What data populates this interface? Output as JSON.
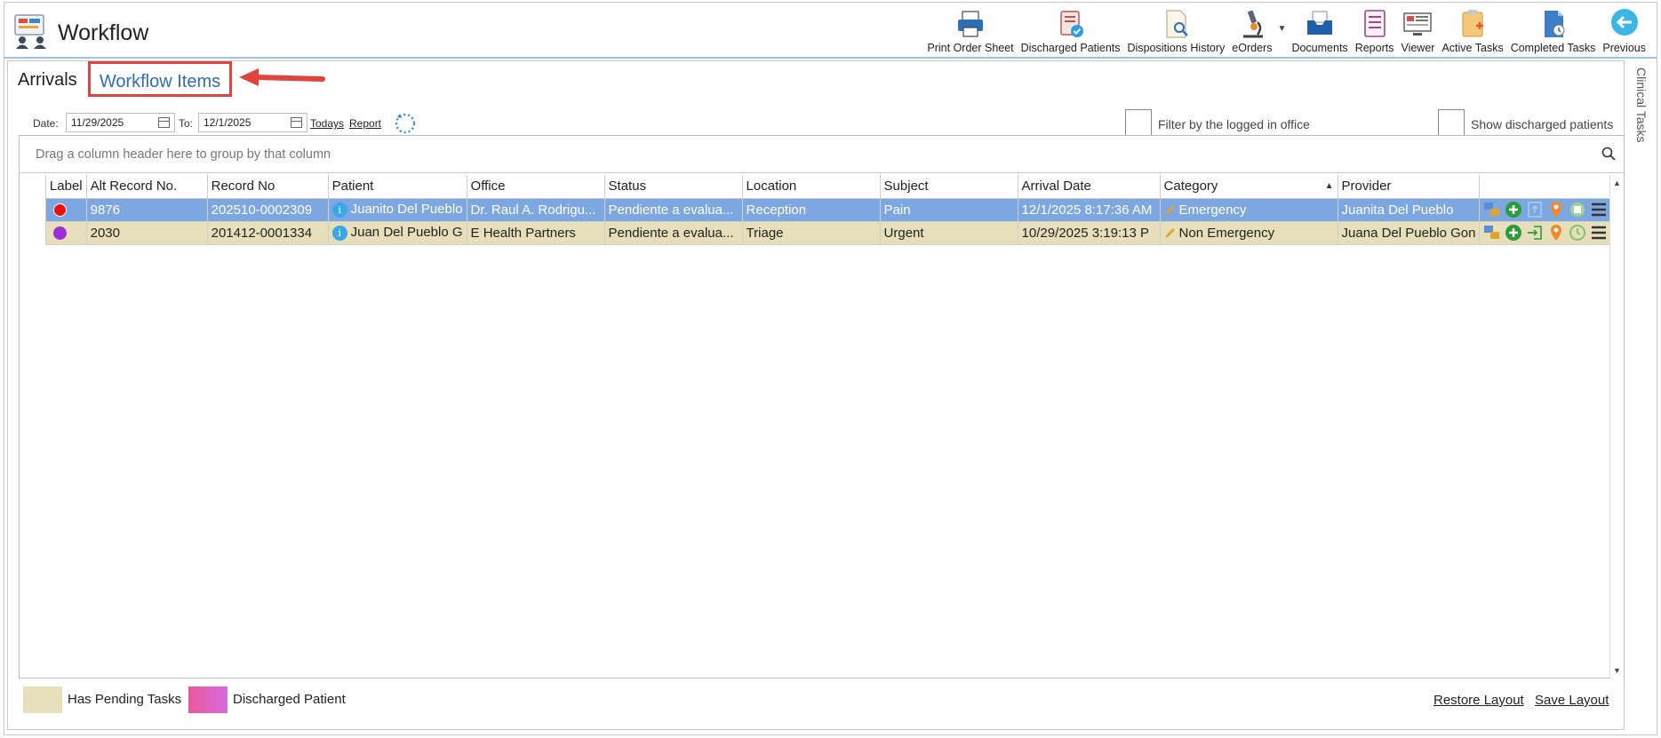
{
  "app": {
    "title": "Workflow"
  },
  "toolbar": [
    {
      "label": "Print Order Sheet",
      "icon": "printer-icon"
    },
    {
      "label": "Discharged Patients",
      "icon": "discharged-patients-icon"
    },
    {
      "label": "Dispositions History",
      "icon": "dispositions-history-icon"
    },
    {
      "label": "eOrders",
      "icon": "microscope-icon"
    },
    {
      "label": "Documents",
      "icon": "documents-tray-icon"
    },
    {
      "label": "Reports",
      "icon": "reports-icon"
    },
    {
      "label": "Viewer",
      "icon": "viewer-icon"
    },
    {
      "label": "Active Tasks",
      "icon": "active-tasks-icon"
    },
    {
      "label": "Completed Tasks",
      "icon": "completed-tasks-icon"
    },
    {
      "label": "Previous",
      "icon": "previous-arrow-icon"
    }
  ],
  "tabs": {
    "arrivals": "Arrivals",
    "workflow_items": "Workflow Items"
  },
  "filters": {
    "date_label": "Date:",
    "date_from": "11/29/2025",
    "to_label": "To:",
    "date_to": "12/1/2025",
    "todays_link": "Todays",
    "report_link": "Report",
    "filter_office_label": "Filter by the logged in office",
    "show_discharged_label": "Show discharged patients"
  },
  "grid": {
    "group_panel_text": "Drag a column header here to group by that column",
    "columns": [
      "Label",
      "Alt Record No.",
      "Record No",
      "Patient",
      "Office",
      "Status",
      "Location",
      "Subject",
      "Arrival Date",
      "Category",
      "Provider"
    ],
    "rows": [
      {
        "label_color": "#e81010",
        "alt_record": "9876",
        "record_no": "202510-0002309",
        "patient": "Juanito Del Pueblo",
        "office": "Dr. Raul A. Rodrigu...",
        "status": "Pendiente a evalua...",
        "location": "Reception",
        "subject": "Pain",
        "arrival_date": "12/1/2025 8:17:36 AM",
        "category": "Emergency",
        "provider": "Juanita Del Pueblo"
      },
      {
        "label_color": "#9b30d9",
        "alt_record": "2030",
        "record_no": "201412-0001334",
        "patient": "Juan Del Pueblo G",
        "office": "E Health Partners",
        "status": "Pendiente a evalua...",
        "location": "Triage",
        "subject": "Urgent",
        "arrival_date": "10/29/2025 3:19:13 P",
        "category": "Non Emergency",
        "provider": "Juana Del Pueblo Gon"
      }
    ]
  },
  "legend": {
    "pending": "Has Pending Tasks",
    "discharged": "Discharged Patient"
  },
  "footer": {
    "restore": "Restore Layout",
    "save": "Save Layout"
  },
  "side_tab": "Clinical Tasks",
  "colors": {
    "selected_row": "#7da7e0",
    "pending_row": "#e6dfb9",
    "accent": "#2f6db5",
    "callout_red": "#e0443e"
  }
}
